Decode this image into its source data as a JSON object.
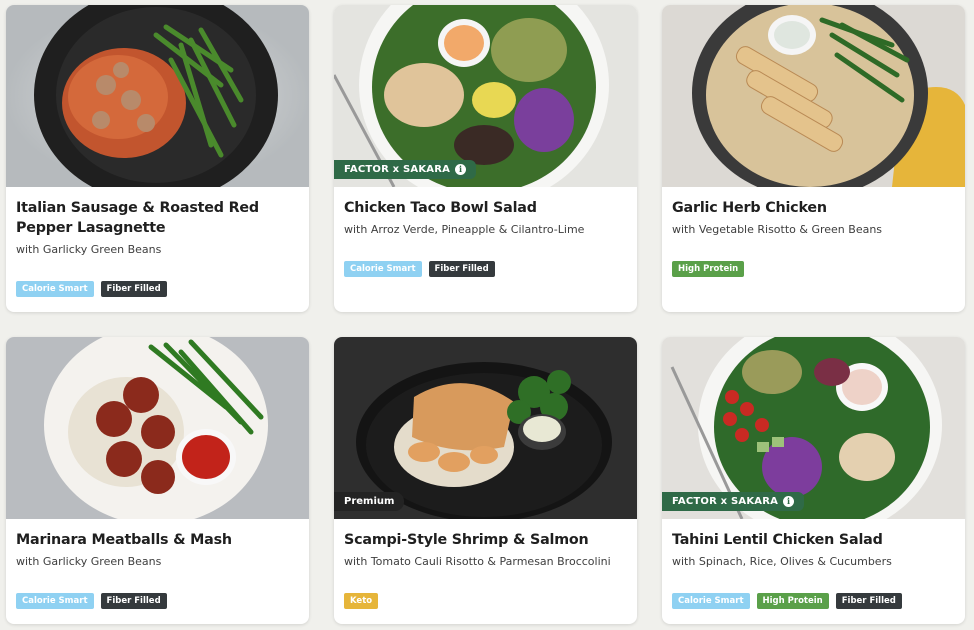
{
  "colors": {
    "calorie_smart": "#8fd1f2",
    "fiber_filled": "#353a3d",
    "high_protein": "#5aa049",
    "keto": "#e6b53a",
    "partner_badge": "#2f6a47",
    "premium_badge": "#232323"
  },
  "meals": [
    {
      "title": "Italian Sausage & Roasted Red Pepper Lasagnette",
      "subtitle": "with Garlicky Green Beans",
      "tags": [
        "Calorie Smart",
        "Fiber Filled"
      ]
    },
    {
      "title": "Chicken Taco Bowl Salad",
      "subtitle": "with Arroz Verde, Pineapple & Cilantro-Lime",
      "badge": "FACTOR x SAKARA",
      "badge_icon": "info-icon",
      "tags": [
        "Calorie Smart",
        "Fiber Filled"
      ]
    },
    {
      "title": "Garlic Herb Chicken",
      "subtitle": "with Vegetable Risotto & Green Beans",
      "tags": [
        "High Protein"
      ]
    },
    {
      "title": "Marinara Meatballs & Mash",
      "subtitle": "with Garlicky Green Beans",
      "tags": [
        "Calorie Smart",
        "Fiber Filled"
      ]
    },
    {
      "title": "Scampi-Style Shrimp & Salmon",
      "subtitle": "with Tomato Cauli Risotto & Parmesan Broccolini",
      "badge": "Premium",
      "tags": [
        "Keto"
      ]
    },
    {
      "title": "Tahini Lentil Chicken Salad",
      "subtitle": "with Spinach, Rice, Olives & Cucumbers",
      "badge": "FACTOR x SAKARA",
      "badge_icon": "info-icon",
      "tags": [
        "Calorie Smart",
        "High Protein",
        "Fiber Filled"
      ]
    }
  ]
}
